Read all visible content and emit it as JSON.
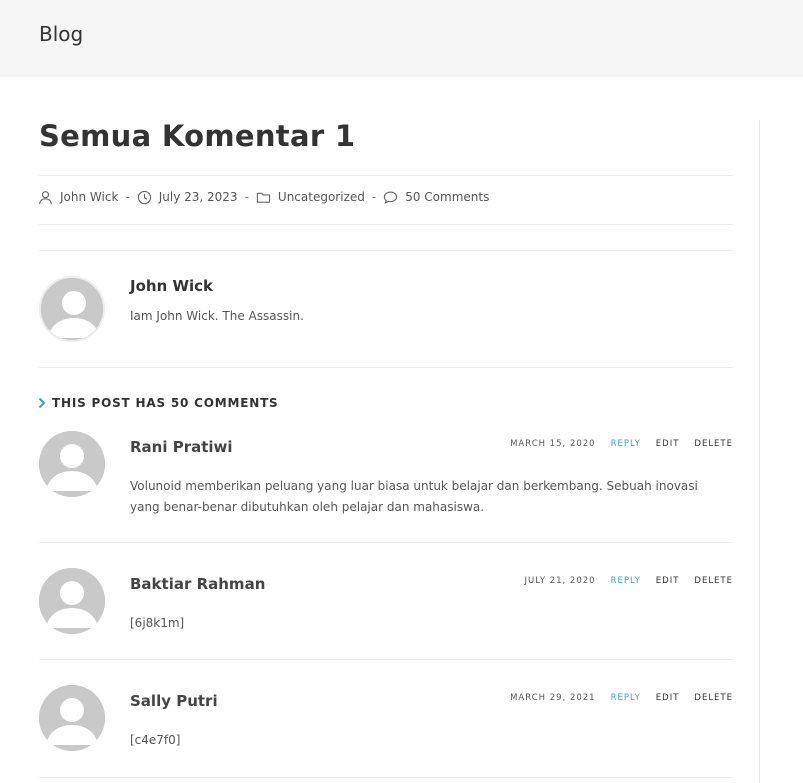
{
  "header": {
    "title": "Blog"
  },
  "post": {
    "title": "Semua Komentar 1",
    "meta": {
      "author": "John Wick",
      "date": "July 23, 2023",
      "category": "Uncategorized",
      "comments_link": "50 Comments",
      "separator": "-"
    }
  },
  "author_box": {
    "name": "John Wick",
    "bio": "Iam John Wick. The Assassin."
  },
  "comments": {
    "heading": "THIS POST HAS 50 COMMENTS",
    "reply_label": "REPLY",
    "edit_label": "EDIT",
    "delete_label": "DELETE",
    "items": [
      {
        "author": "Rani Pratiwi",
        "date": "MARCH 15, 2020",
        "text": "Volunoid memberikan peluang yang luar biasa untuk belajar dan berkembang. Sebuah inovasi yang benar-benar dibutuhkan oleh pelajar dan mahasiswa."
      },
      {
        "author": "Baktiar Rahman",
        "date": "JULY 21, 2020",
        "text": "[6j8k1m]"
      },
      {
        "author": "Sally Putri",
        "date": "MARCH 29, 2021",
        "text": "[c4e7f0]"
      }
    ]
  },
  "colors": {
    "accent": "#3aa0d0",
    "header_bg": "#f5f5f5",
    "avatar_bg": "#c9c9c9"
  }
}
